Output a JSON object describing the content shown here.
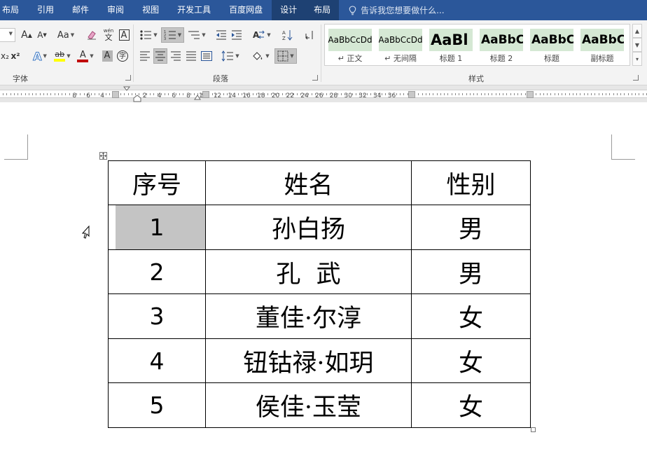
{
  "tabs": [
    "布局",
    "引用",
    "邮件",
    "审阅",
    "视图",
    "开发工具",
    "百度网盘",
    "设计",
    "布局"
  ],
  "tell_me": "告诉我您想要做什么...",
  "ribbon": {
    "font_group_label": "字体",
    "paragraph_group_label": "段落",
    "styles_group_label": "样式",
    "font_buttons": {
      "grow": "A",
      "shrink": "A",
      "case": "Aa",
      "phonetic": "wén",
      "border_char": "A",
      "subscript": "x₂",
      "superscript": "x²",
      "text_effects": "A",
      "highlight": "ab",
      "font_color": "A",
      "char_shading": "A",
      "enclose": "字"
    },
    "styles": [
      {
        "sample": "AaBbCcDd",
        "name": "↵ 正文"
      },
      {
        "sample": "AaBbCcDd",
        "name": "↵ 无间隔"
      },
      {
        "sample": "AaBl",
        "name": "标题 1"
      },
      {
        "sample": "AaBbC",
        "name": "标题 2"
      },
      {
        "sample": "AaBbC",
        "name": "标题"
      },
      {
        "sample": "AaBbC",
        "name": "副标题"
      }
    ]
  },
  "ruler": {
    "labels": [
      "8",
      "6",
      "4",
      "2",
      "2",
      "4",
      "6",
      "8",
      "10",
      "12",
      "14",
      "16",
      "18",
      "20",
      "22",
      "24",
      "26",
      "28",
      "30",
      "32",
      "34",
      "36"
    ]
  },
  "table": {
    "headers": [
      "序号",
      "姓名",
      "性别"
    ],
    "rows": [
      [
        "1",
        "孙白扬",
        "男"
      ],
      [
        "2",
        "孔  武",
        "男"
      ],
      [
        "3",
        "董佳·尔淳",
        "女"
      ],
      [
        "4",
        "钮钴禄·如玥",
        "女"
      ],
      [
        "5",
        "侯佳·玉莹",
        "女"
      ]
    ]
  },
  "colors": {
    "title_bar": "#2b579a",
    "ribbon_bg": "#f3f3f3",
    "selected_cell": "#c4c4c4",
    "style_gallery_highlight": "#d5e8d4"
  }
}
